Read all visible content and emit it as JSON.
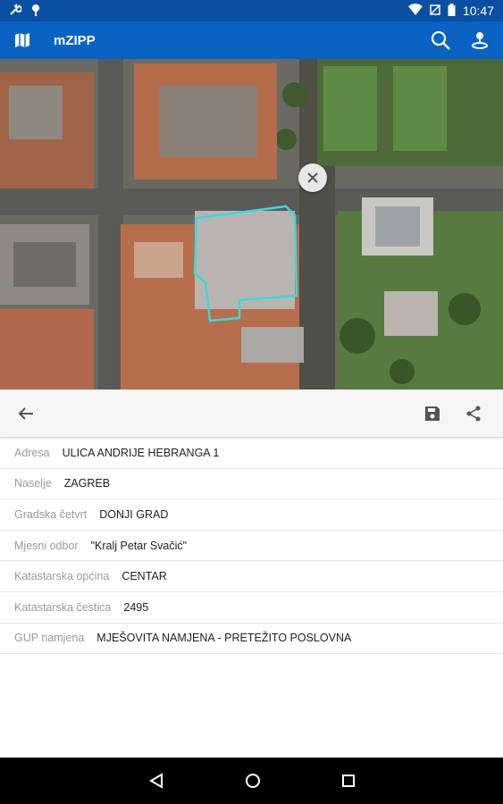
{
  "status": {
    "time": "10:47"
  },
  "appbar": {
    "title": "mZIPP"
  },
  "icons": {
    "map": "map-icon",
    "search": "search-icon",
    "location": "location-icon",
    "close": "close-icon",
    "back": "back-arrow-icon",
    "save": "save-icon",
    "share": "share-icon"
  },
  "colors": {
    "statusbar": "#0b4fa3",
    "appbar": "#0a62c2",
    "parcel_outline": "#3ad7e0"
  },
  "details": [
    {
      "label": "Adresa",
      "value": "ULICA ANDRIJE HEBRANGA 1"
    },
    {
      "label": "Naselje",
      "value": "ZAGREB"
    },
    {
      "label": "Gradska četvrt",
      "value": "DONJI GRAD"
    },
    {
      "label": "Mjesni odbor",
      "value": "\"Kralj Petar Svačić\""
    },
    {
      "label": "Katastarska općina",
      "value": "CENTAR"
    },
    {
      "label": "Katastarska čestica",
      "value": "2495"
    },
    {
      "label": "GUP namjena",
      "value": "MJEŠOVITA NAMJENA - PRETEŽITO POSLOVNA"
    }
  ]
}
